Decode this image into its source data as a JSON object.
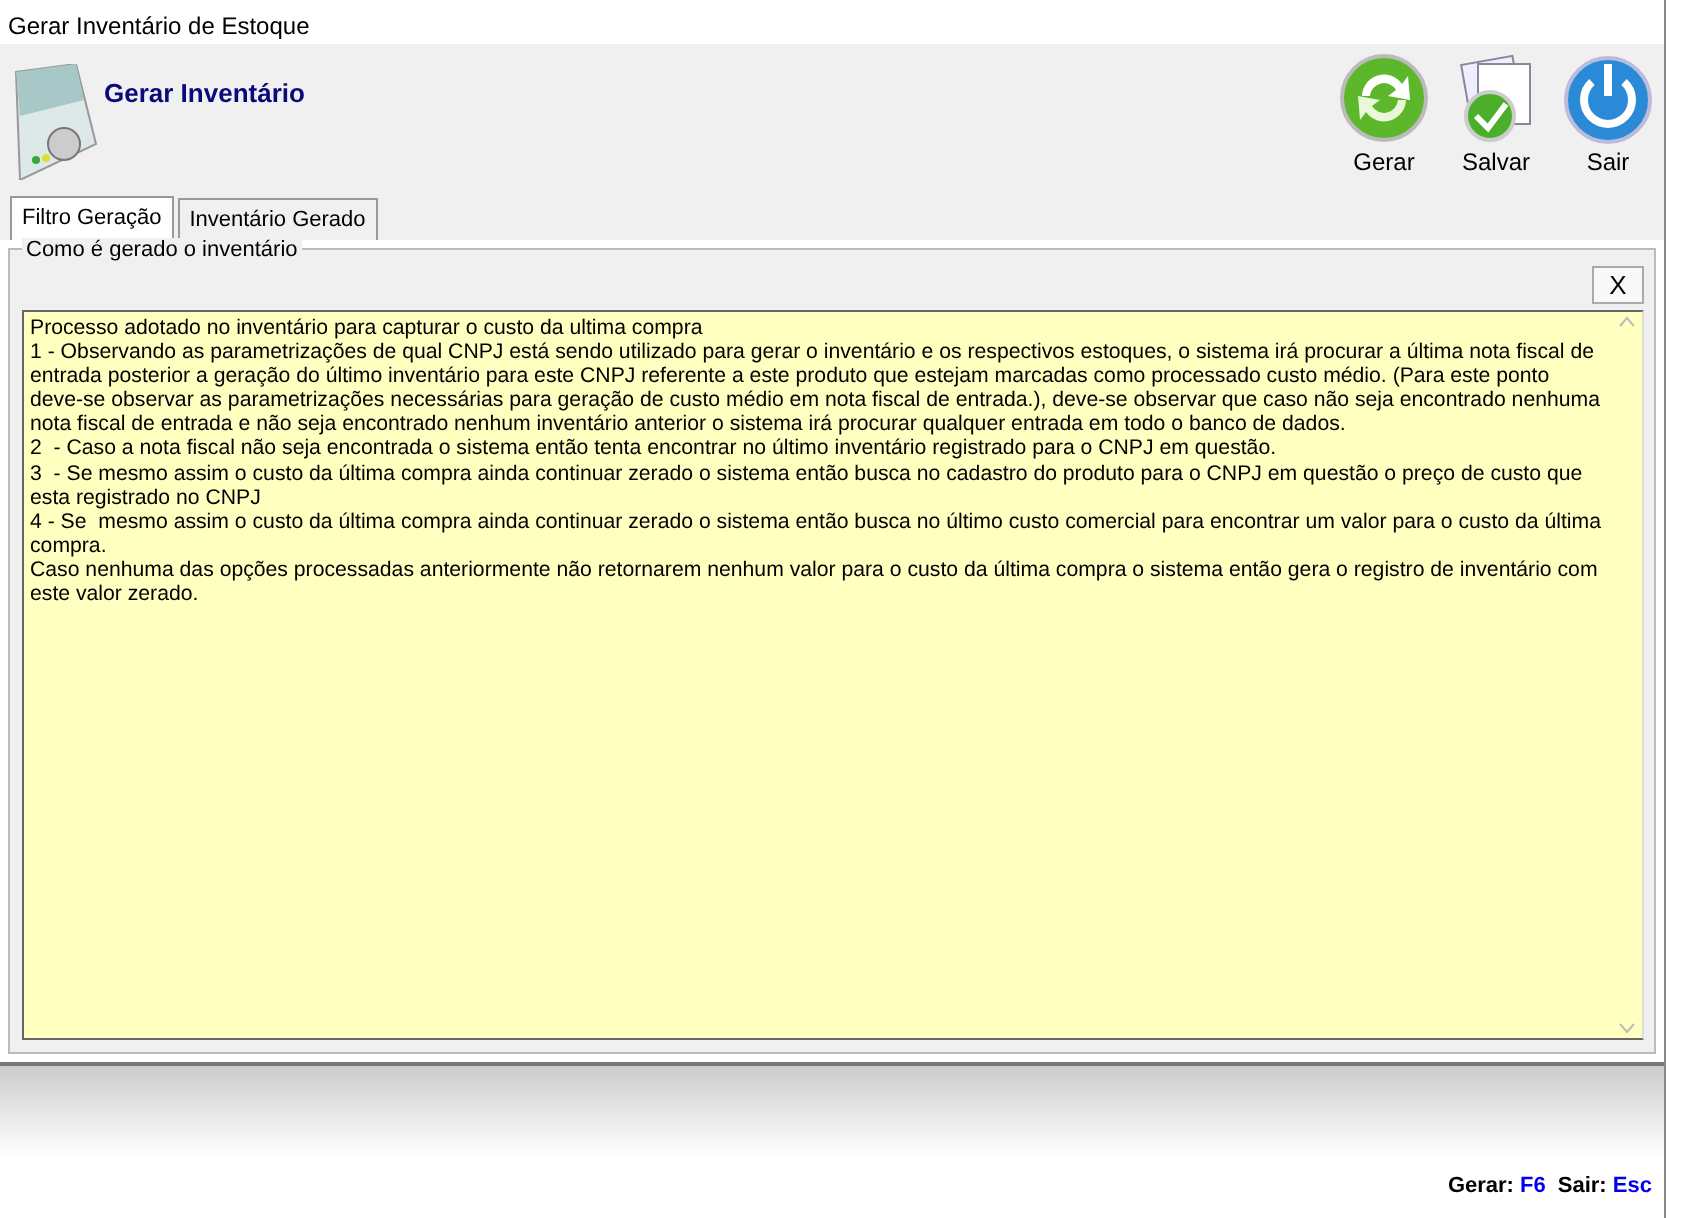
{
  "window": {
    "title": "Gerar Inventário de Estoque"
  },
  "header": {
    "title": "Gerar Inventário"
  },
  "toolbar": [
    {
      "kind": "refresh",
      "label": "Gerar"
    },
    {
      "kind": "save",
      "label": "Salvar"
    },
    {
      "kind": "power",
      "label": "Sair"
    }
  ],
  "tabs": [
    {
      "label": "Filtro Geração",
      "selected": true
    },
    {
      "label": "Inventário Gerado",
      "selected": false
    }
  ],
  "group": {
    "title": "Como é gerado o inventário",
    "close_button": "X"
  },
  "memo": [
    "Processo adotado no inventário para capturar o custo da ultima compra",
    "1 - Observando as parametrizações de qual CNPJ está sendo utilizado para gerar o inventário e os respectivos estoques, o sistema irá procurar a última nota fiscal de entrada posterior a geração do último inventário para este CNPJ referente a este produto que estejam marcadas como processado custo médio. (Para este ponto deve-se observar as parametrizações necessárias para geração de custo médio em nota fiscal de entrada.), deve-se observar que caso não seja encontrado nenhuma nota fiscal de entrada e não seja encontrado nenhum inventário anterior o sistema irá procurar qualquer entrada em todo o banco de dados.",
    "2  - Caso a nota fiscal não seja encontrada o sistema então tenta encontrar no último inventário registrado para o CNPJ em questão.",
    "3  - Se mesmo assim o custo da última compra ainda continuar zerado o sistema então busca no cadastro do produto para o CNPJ em questão o preço de custo que esta registrado no CNPJ",
    "4 - Se  mesmo assim o custo da última compra ainda continuar zerado o sistema então busca no último custo comercial para encontrar um valor para o custo da última compra.",
    "Caso nenhuma das opções processadas anteriormente não retornarem nenhum valor para o custo da última compra o sistema então gera o registro de inventário com este valor zerado."
  ],
  "shortcuts": [
    {
      "label": "Gerar:",
      "key": "F6"
    },
    {
      "label": "Sair:",
      "key": "Esc"
    }
  ]
}
